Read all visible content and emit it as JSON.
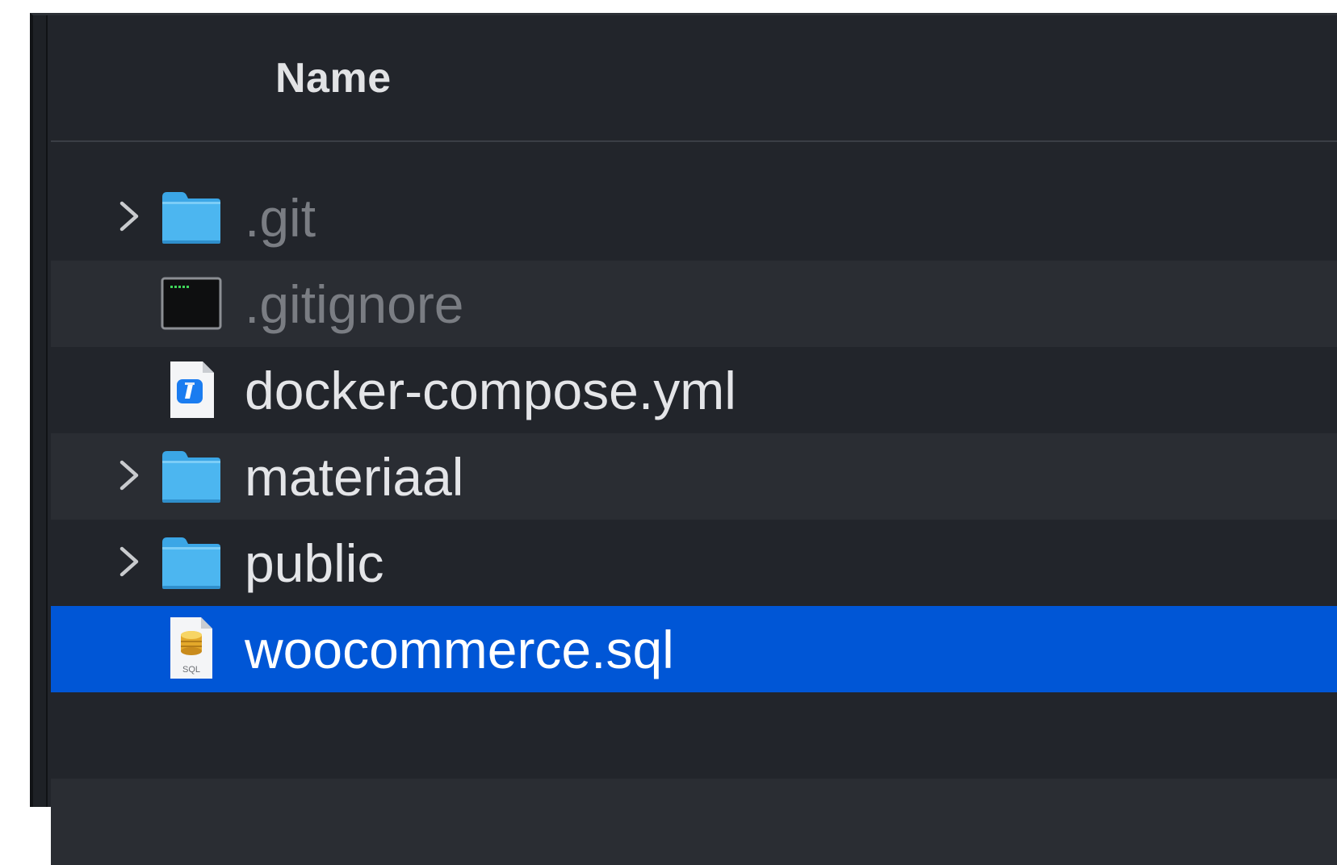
{
  "header": {
    "name_label": "Name"
  },
  "files": [
    {
      "name": ".git",
      "kind": "folder",
      "expandable": true,
      "hidden": true,
      "selected": false,
      "icon": "folder-icon"
    },
    {
      "name": ".gitignore",
      "kind": "terminal-file",
      "expandable": false,
      "hidden": true,
      "selected": false,
      "icon": "terminal-document-icon"
    },
    {
      "name": "docker-compose.yml",
      "kind": "yaml-file",
      "expandable": false,
      "hidden": false,
      "selected": false,
      "icon": "xcode-document-icon"
    },
    {
      "name": "materiaal",
      "kind": "folder",
      "expandable": true,
      "hidden": false,
      "selected": false,
      "icon": "folder-icon"
    },
    {
      "name": "public",
      "kind": "folder",
      "expandable": true,
      "hidden": false,
      "selected": false,
      "icon": "folder-icon"
    },
    {
      "name": "woocommerce.sql",
      "kind": "sql-file",
      "expandable": false,
      "hidden": false,
      "selected": true,
      "icon": "sql-document-icon",
      "badge": "SQL"
    }
  ],
  "colors": {
    "background": "#22252b",
    "row_alternate": "#2a2d33",
    "selection": "#0056d6",
    "folder_blue": "#45b2ee",
    "text": "#e4e5e8",
    "text_hidden": "#7a7d83"
  }
}
